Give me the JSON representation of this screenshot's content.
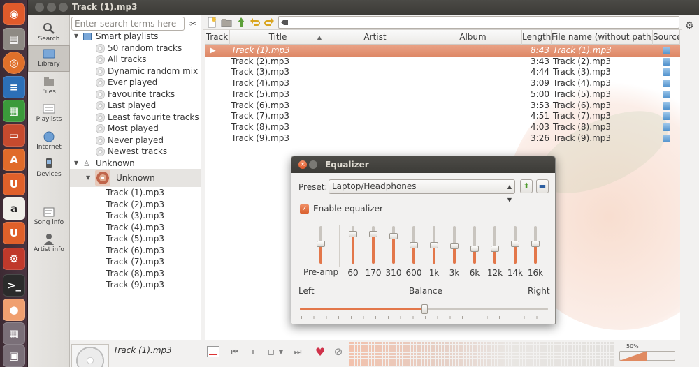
{
  "window": {
    "title": "Track (1).mp3"
  },
  "launcher": {
    "apps": [
      "ubuntu-icon",
      "files-icon",
      "firefox-icon",
      "writer-icon",
      "calc-icon",
      "impress-icon",
      "software-center-icon",
      "ubuntu-one-icon",
      "amazon-icon",
      "ubuntu-one-music-icon",
      "settings-icon",
      "terminal-icon",
      "clementine-icon",
      "workspaces-icon",
      "trash-icon"
    ]
  },
  "tabs": [
    {
      "label": "Search",
      "icon": "search-icon"
    },
    {
      "label": "Library",
      "icon": "library-icon"
    },
    {
      "label": "Files",
      "icon": "files-icon"
    },
    {
      "label": "Playlists",
      "icon": "playlists-icon"
    },
    {
      "label": "Internet",
      "icon": "internet-icon"
    },
    {
      "label": "Devices",
      "icon": "devices-icon"
    },
    {
      "label": "Song info",
      "icon": "song-info-icon"
    },
    {
      "label": "Artist info",
      "icon": "artist-info-icon"
    }
  ],
  "library": {
    "search_placeholder": "Enter search terms here",
    "smart_header": "Smart playlists",
    "smart_items": [
      "50 random tracks",
      "All tracks",
      "Dynamic random mix",
      "Ever played",
      "Favourite tracks",
      "Last played",
      "Least favourite tracks",
      "Most played",
      "Never played",
      "Newest tracks"
    ],
    "artist": "Unknown",
    "album": "Unknown",
    "album_tracks": [
      "Track (1).mp3",
      "Track (2).mp3",
      "Track (3).mp3",
      "Track (4).mp3",
      "Track (5).mp3",
      "Track (6).mp3",
      "Track (7).mp3",
      "Track (8).mp3",
      "Track (9).mp3"
    ]
  },
  "playlist": {
    "columns": [
      "Track",
      "Title",
      "Artist",
      "Album",
      "Length",
      "File name (without path)",
      "Source"
    ],
    "rows": [
      {
        "title": "Track (1).mp3",
        "length": "8:43",
        "filename": "Track (1).mp3",
        "playing": true
      },
      {
        "title": "Track (2).mp3",
        "length": "3:43",
        "filename": "Track (2).mp3"
      },
      {
        "title": "Track (3).mp3",
        "length": "4:44",
        "filename": "Track (3).mp3"
      },
      {
        "title": "Track (4).mp3",
        "length": "3:09",
        "filename": "Track (4).mp3"
      },
      {
        "title": "Track (5).mp3",
        "length": "5:00",
        "filename": "Track (5).mp3"
      },
      {
        "title": "Track (6).mp3",
        "length": "3:53",
        "filename": "Track (6).mp3"
      },
      {
        "title": "Track (7).mp3",
        "length": "4:51",
        "filename": "Track (7).mp3"
      },
      {
        "title": "Track (8).mp3",
        "length": "4:03",
        "filename": "Track (8).mp3"
      },
      {
        "title": "Track (9).mp3",
        "length": "3:26",
        "filename": "Track (9).mp3"
      }
    ]
  },
  "equalizer": {
    "title": "Equalizer",
    "preset_label": "Preset:",
    "preset_value": "Laptop/Headphones",
    "enable_label": "Enable equalizer",
    "enabled": true,
    "preamp_label": "Pre-amp",
    "bands": [
      "60",
      "170",
      "310",
      "600",
      "1k",
      "3k",
      "6k",
      "12k",
      "14k",
      "16k"
    ],
    "levels": [
      0.52,
      0.78,
      0.78,
      0.74,
      0.5,
      0.5,
      0.48,
      0.4,
      0.4,
      0.52,
      0.52
    ],
    "balance_label": "Balance",
    "left_label": "Left",
    "right_label": "Right",
    "balance": 0.5
  },
  "nowplaying": {
    "title": "Track (1).mp3"
  },
  "player": {
    "volume_text": "50%",
    "volume": 0.5
  },
  "colors": {
    "accent": "#e3774a",
    "launcher": "#3d2a33"
  }
}
